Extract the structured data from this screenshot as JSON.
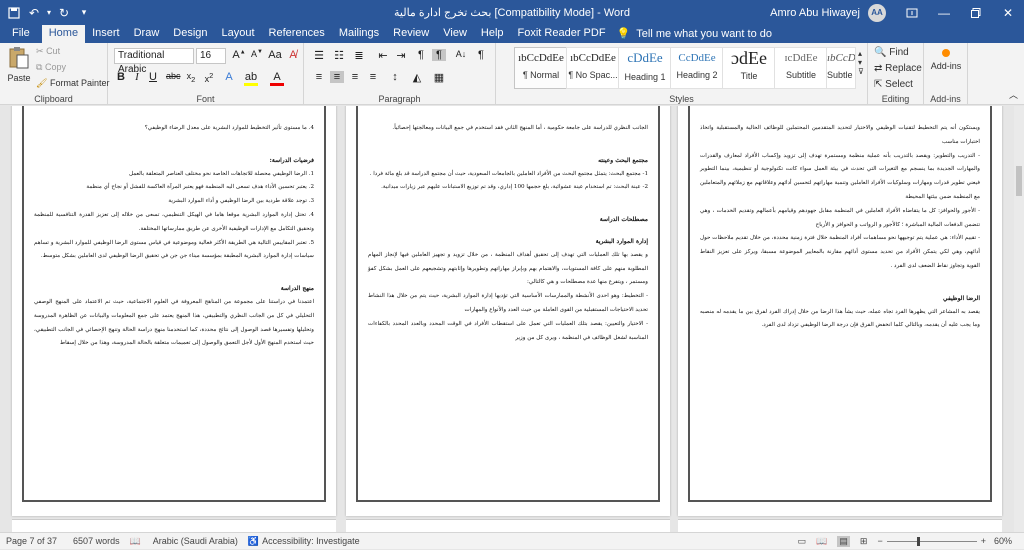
{
  "titlebar": {
    "doc_title": "بحث تخرج ادارة مالية [Compatibility Mode] - Word",
    "user": "Amro Abu Hiwayej",
    "avatar": "AA"
  },
  "tabs": [
    "File",
    "Home",
    "Insert",
    "Draw",
    "Design",
    "Layout",
    "References",
    "Mailings",
    "Review",
    "View",
    "Help",
    "Foxit Reader PDF"
  ],
  "tellme": "Tell me what you want to do",
  "clipboard": {
    "paste": "Paste",
    "cut": "Cut",
    "copy": "Copy",
    "format_painter": "Format Painter",
    "label": "Clipboard"
  },
  "font": {
    "name": "Traditional Arabic",
    "size": "16",
    "label": "Font"
  },
  "paragraph": {
    "label": "Paragraph"
  },
  "styles": {
    "label": "Styles",
    "items": [
      {
        "preview": "ıbCcDdEe",
        "name": "¶ Normal"
      },
      {
        "preview": "ıbCcDdEe",
        "name": "¶ No Spac..."
      },
      {
        "preview": "cDdEe",
        "name": "Heading 1"
      },
      {
        "preview": "CcDdEe",
        "name": "Heading 2"
      },
      {
        "preview": "ɔdEe",
        "name": "Title"
      },
      {
        "preview": "ɪcDdEe",
        "name": "Subtitle"
      },
      {
        "preview": "ıbCcDdEe",
        "name": "Subtle Em..."
      }
    ]
  },
  "editing": {
    "find": "Find",
    "replace": "Replace",
    "select": "Select",
    "label": "Editing"
  },
  "addins": {
    "btn": "Add-ins",
    "label": "Add-ins"
  },
  "page_right": [
    "4. ما مستوى تأثير التخطيط للموارد البشرية على معدل الرضاء الوظيفي؟",
    "",
    "فرضيات الدراسة:",
    "1. الرضا الوظيفي محصلة للاتجاهات الخاصة نحو مختلف العناصر المتعلقة بالعمل",
    "2. يعتبر تحسين الأداء هدف تسعى اليه المنظمة فهو يعتبر المرآة العاكسة للفشل أو نجاح أي منظمة",
    "3. توجد علاقة طردية بين الرضا الوظيفي و أداء الموارد البشرية",
    "4. تحتل إدارة الموارد البشرية موقعا هاما في الهيكل التنظيمي، تسعى من خلاله إلى تعزيز القدرة التنافسية للمنظمة وتحقيق التكامل مع الإدارات الوظيفية الأخرى عن طريق ممارساتها المختلفة.",
    "5. تعتبر المقاييس التالية هي الطريقة الأكثر فعالية وموضوعية في قياس مستوى الرضا الوظيفي للموارد البشرية و تساهم سياسات إدارة الموارد البشرية المطبقة بمؤسسة ميناء جن جن في تحقيق الرضا الوظيفي لدى العاملين بشكل متوسط.",
    "",
    "منهج الدراسة",
    "اعتمدنا في دراستنا على مجموعة من المناهج المعروفة في العلوم الاجتماعية، حيث تم الاعتماد على المنهج الوصفي التحليلي في كل من الجانب النظري والتطبيقي، هذا المنهج يعتمد على جمع المعلومات والبيانات عن الظاهرة المدروسة وتحليلها وتفسيرها قصد الوصول إلى نتائج محددة، كما استخدمنا منهج دراسة الحالة وتنهج الإحصائي في الجانب التطبيقي، حيث استخدم المنهج الأول لأجل التعمق والوصول إلى تعميمات متعلقة بالحالة المدروسة، وهذا من خلال إسقاط"
  ],
  "page_middle": [
    "الجانب النظري للدراسة على جامعة حكومية ، أما المنهج الثاني فقد استخدم في جمع البيانات ومعالجتها إحصائياً.",
    "",
    "مجتمع البحث وعينته",
    "1- مجتمع البحث: يتمثل مجتمع البحث من الأفراد العاملين بالجامعات السعودية، حيث أن مجتمع الدراسة قد بلغ مائة فردا .",
    "2- عينة البحث: تم استخدام عينة عشوائية، بلغ حجمها 100 إداري، وقد تم توزيع الاستبانات عليهم عبر زيارات ميدانية.",
    "",
    "مصطلحات الدراسة",
    "إدارة الموارد البشرية",
    "و يقصد بها تلك العمليات التي تهدف إلى تحقيق أهداف المنظمة ، من خلال تزويد و تجهيز العاملين فيها لإنجاز المهام المطلوبة منهم على كافة المستويات، والاهتمام بهم وبإبراز مهاراتهم وتطويرها وإثابتهم وتشجيعهم على العمل بشكل كفؤ ومستمر ، ويتفرع منها عدة مصطلحات و هي كالتالي:",
    "- التخطيط: وهو احدى الأنشطة والممارسات الأساسية التي تؤديها إدارة الموارد البشرية، حيث يتم من خلال هذا النشاط تحديد الاحتياجات المستقبلية من القوى العاملة من حيث العدد والأنواع والمهارات",
    "- الاختيار والتعيين: يقصد بتلك العمليات التي تعمل على استقطاب الأفراد في الوقت المحدد وبالعدد المحدد بالكفاءات المناسبة لشغل الوظائف في المنظمة ، ويرى كل من وزير"
  ],
  "page_left": [
    "ويستكون أنه يتم التخطيط لتقنيات الوظيفي والاختيار لتحديد المتقدمين المحتملين للوظائف الحالية والمستقبلية واتخاذ اختبارات مناسب",
    "- التدريب والتطوير: ويقصد بالتدريب بأنه عملية منظمة ومستمرة تهدف إلى تزويد وإكساب الأفراد لمعارف والقدرات والمهارات الجديدة بما ينسجم مع التغيرات التي تحدث في بيئة العمل سواء كانت تكنولوجية أو تنظيمية، بينما التطوير فيعني تطوير قدرات ومهارات وسلوكيات الأفراد العاملين وتنمية مهاراتهم لتحسين أدائهم وعلاقاتهم مع زملائهم والمتعاملين مع المنظمة ضمن بيئتها المحيطة",
    "- الأجور والحوافز: كل ما يتقاضاه الأفراد العاملين في المنظمة مقابل جهودهم وقيامهم بأعمالهم وتقديم الخدمات ، وهي تتضمن الدفعات المالية المباشرة ؛ كالأجور و الرواتب و الحوافز و الأرباح",
    "- تقييم الأداء: هي عملية يتم توجيهها نحو مساهمات أفراد المنظمة خلال فترة زمنية محددة، من خلال تقديم ملاحظات حول أدائهم، وهي لكي يتمكن الأفراد من تحديد مستوى أدائهم مقارنة بالمعايير الموضوعة مسبقا، ويركز على تعزيز النقاط القوية وتجاوز نقاط الضعف لدى الفرد .",
    "",
    "الرضا الوظيفي",
    "يقصد به المشاعر التي يظهرها الفرد تجاه عمله، حيث يشأ هذا الرضا من خلال إدراك الفرد لفرق بين ما يقدمه له منصبه وما يجب عليه أن يقدمه، وبالتالي كلما انخفض الفرق فإن درجة الرضا الوظيفي تزداد لدى الفرد."
  ],
  "status": {
    "page": "Page 7 of 37",
    "words": "6507 words",
    "lang": "Arabic (Saudi Arabia)",
    "access": "Accessibility: Investigate",
    "zoom": "60%"
  }
}
